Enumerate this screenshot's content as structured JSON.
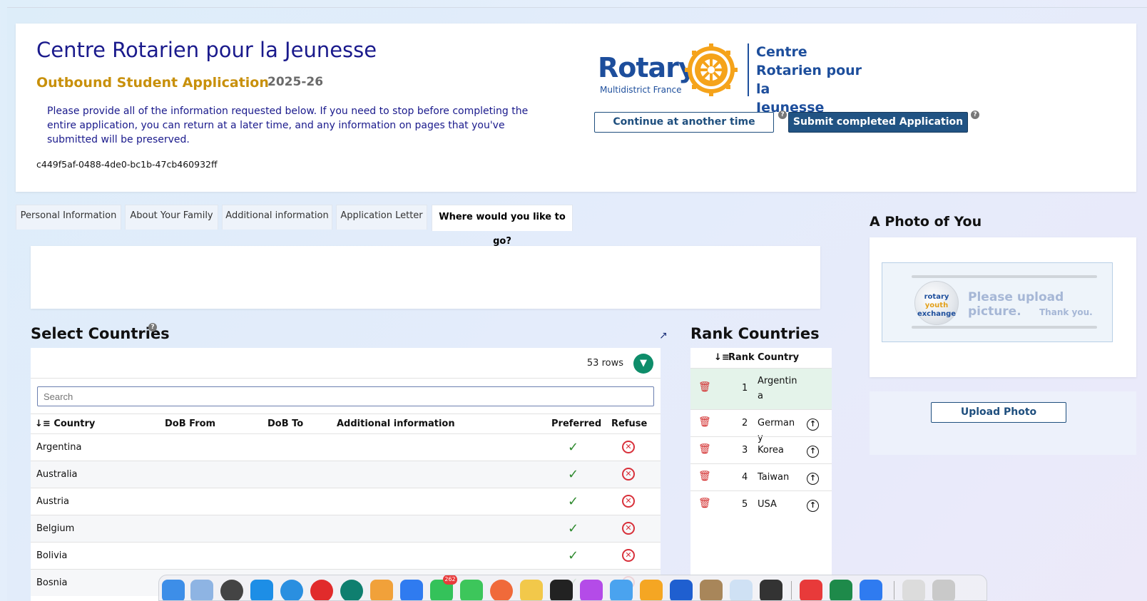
{
  "header": {
    "org_title": "Centre Rotarien pour la Jeunesse",
    "subtitle": "Outbound Student Application",
    "year": "2025-26",
    "intro": "Please provide all of the information requested below. If you need to stop before completing the entire application, you can return at a later time, and any information on pages that you've submitted will be preserved.",
    "application_id": "c449f5af-0488-4de0-bc1b-47cb460932ff",
    "logo": {
      "word": "Rotary",
      "sub": "Multidistrict France",
      "right_line1": "Centre",
      "right_line2": "Rotarien pour la",
      "right_line3": "Jeunesse"
    },
    "continue_label": "Continue at another time",
    "submit_label": "Submit completed Application",
    "help_glyph": "?"
  },
  "tabs": [
    {
      "label": "Personal Information"
    },
    {
      "label": "About Your Family"
    },
    {
      "label": "Additional information"
    },
    {
      "label": "Application Letter"
    },
    {
      "label": "Where would you like to go?"
    }
  ],
  "select_countries": {
    "title": "Select Countries",
    "rows_count": "53 rows",
    "search_placeholder": "Search",
    "columns": [
      "Country",
      "DoB From",
      "DoB To",
      "Additional information",
      "Preferred",
      "Refuse"
    ],
    "rows": [
      "Argentina",
      "Australia",
      "Austria",
      "Belgium",
      "Bolivia",
      "Bosnia"
    ]
  },
  "rank_countries": {
    "title": "Rank Countries",
    "columns": [
      "Rank",
      "Country"
    ],
    "rows": [
      {
        "rank": "1",
        "country": "Argentina"
      },
      {
        "rank": "2",
        "country": "Germany"
      },
      {
        "rank": "3",
        "country": "Korea"
      },
      {
        "rank": "4",
        "country": "Taiwan"
      },
      {
        "rank": "5",
        "country": "USA"
      }
    ]
  },
  "photo": {
    "title": "A Photo of You",
    "placeholder_line1": "Please upload picture.",
    "placeholder_line2": "Thank you.",
    "logo_line1": "rotary",
    "logo_line2": "youth",
    "logo_line3": "exchange",
    "upload_label": "Upload Photo"
  },
  "dock": {
    "badge_count": "262"
  },
  "colors": {
    "brand_blue": "#1d4e9c",
    "title_navy": "#1a1a8c",
    "gold": "#c8900b",
    "submit_bg": "#215383",
    "check_green": "#2f8a2f",
    "refuse_red": "#d8303a",
    "filter_teal": "#0e8d6a",
    "rank_highlight": "#e4f3ea"
  }
}
